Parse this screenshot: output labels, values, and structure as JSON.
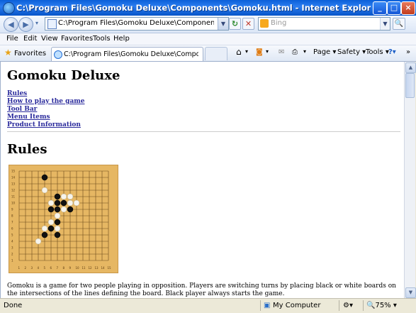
{
  "window": {
    "title": "C:\\Program Files\\Gomoku Deluxe\\Components\\Gomoku.html - Internet Explorer, optimized for Bing and MSN"
  },
  "address_bar": {
    "url": "C:\\Program Files\\Gomoku Deluxe\\Components\\Gomoku.html",
    "search_placeholder": "Bing"
  },
  "menu": {
    "file": "File",
    "edit": "Edit",
    "view": "View",
    "favorites": "Favorites",
    "tools": "Tools",
    "help": "Help"
  },
  "favorites_bar": {
    "favorites_label": "Favorites",
    "tab_title": "C:\\Program Files\\Gomoku Deluxe\\Components\\Gomok..."
  },
  "command_bar": {
    "page": "Page",
    "safety": "Safety",
    "tools": "Tools"
  },
  "page": {
    "heading": "Gomoku Deluxe",
    "links": [
      "Rules",
      "How to play the game",
      "Tool Bar",
      "Menu Items",
      "Product Information"
    ],
    "section_heading": "Rules",
    "board_row_labels": [
      "15",
      "14",
      "13",
      "12",
      "11",
      "10",
      "9",
      "8",
      "7",
      "6",
      "5",
      "4",
      "3",
      "2",
      "1"
    ],
    "board_col_labels": [
      "1",
      "2",
      "3",
      "4",
      "5",
      "6",
      "7",
      "8",
      "9",
      "10",
      "11",
      "12",
      "13",
      "14",
      "15"
    ],
    "body_text": "Gomoku is a game for two people playing in opposition. Players are switching turns by placing black or white boards on the intersections of the lines defining the board. Black player always starts the game."
  },
  "status_bar": {
    "status": "Done",
    "zone": "My Computer",
    "zoom": "75%"
  },
  "colors": {
    "titlebar": "#0a5fd8",
    "board": "#e6b763",
    "link": "#2a2a9c"
  }
}
